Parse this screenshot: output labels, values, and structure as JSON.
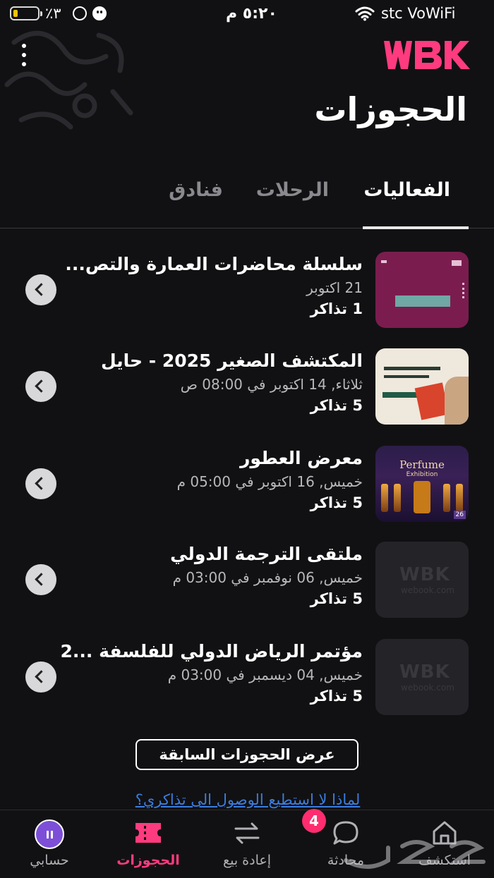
{
  "status_bar": {
    "battery_percent": "٪٣",
    "time": "٥:٢٠ م",
    "carrier": "stc VoWiFi",
    "battery_color": "#f5c400"
  },
  "header": {
    "logo": "WBK",
    "title": "الحجوزات",
    "menu_icon": "kebab-menu-icon",
    "brand_color": "#ff3b7f"
  },
  "tabs": [
    {
      "label": "الفعاليات",
      "active": true
    },
    {
      "label": "الرحلات",
      "active": false
    },
    {
      "label": "فنادق",
      "active": false
    }
  ],
  "bookings": [
    {
      "title": "سلسلة محاضرات العمارة والتص...",
      "date": "21 اكتوبر",
      "tickets": "1 تذاكر"
    },
    {
      "title": "المكتشف الصغير 2025 - حايل",
      "date": "ثلاثاء, 14 اكتوبر في 08:00 ص",
      "tickets": "5 تذاكر"
    },
    {
      "title": "معرض العطور",
      "date": "خميس, 16 اكتوبر في 05:00 م",
      "tickets": "5 تذاكر"
    },
    {
      "title": "ملتقى الترجمة الدولي",
      "date": "خميس, 06 نوفمبر في 03:00 م",
      "tickets": "5 تذاكر"
    },
    {
      "title": "مؤتمر الرياض الدولي للفلسفة ...2",
      "date": "خميس, 04 ديسمبر في 03:00 م",
      "tickets": "5 تذاكر"
    }
  ],
  "thumbnails": {
    "perfume_title": "Perfume",
    "perfume_subtitle": "Exhibition",
    "perfume_badge": "26",
    "placeholder_logo": "WBK",
    "placeholder_url": "webook.com"
  },
  "past_bookings_button": "عرض الحجوزات السابقة",
  "help_link": "لماذا لا استطيع الوصول الى تذاكري؟",
  "bottom_nav": [
    {
      "label": "حسابي",
      "icon": "avatar-icon",
      "active": false
    },
    {
      "label": "الحجوزات",
      "icon": "ticket-icon",
      "active": true
    },
    {
      "label": "إعادة بيع",
      "icon": "resale-arrows-icon",
      "active": false
    },
    {
      "label": "محادثة",
      "icon": "chat-bubble-icon",
      "active": false,
      "badge": "4"
    },
    {
      "label": "استكشف",
      "icon": "home-icon",
      "active": false
    }
  ],
  "watermark": "حراج"
}
